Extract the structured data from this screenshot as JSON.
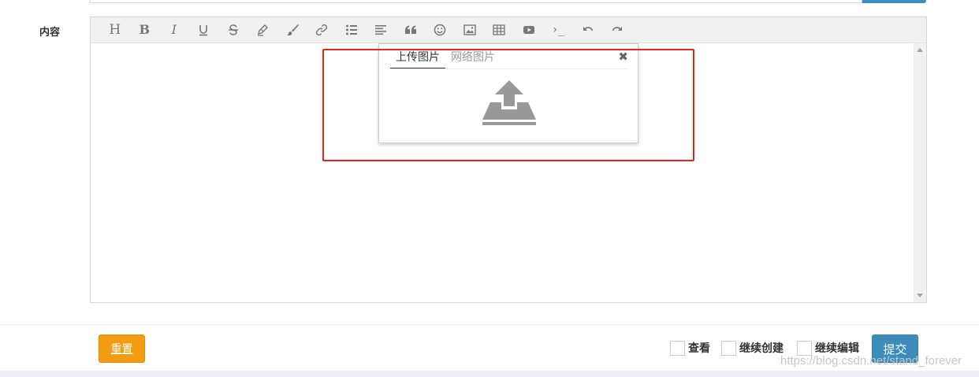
{
  "form": {
    "content_label": "内容"
  },
  "toolbar": {
    "heading_glyph": "H",
    "bold_glyph": "B",
    "italic_glyph": "I",
    "code_glyph": "›_",
    "items": [
      "heading-icon",
      "bold-icon",
      "italic-icon",
      "underline-icon",
      "strikethrough-icon",
      "highlighter-icon",
      "brush-icon",
      "link-icon",
      "bullet-list-icon",
      "align-left-icon",
      "quote-icon",
      "emoji-icon",
      "image-icon",
      "table-icon",
      "video-icon",
      "code-icon",
      "undo-icon",
      "redo-icon"
    ]
  },
  "image_popup": {
    "tabs": [
      "上传图片",
      "网络图片"
    ],
    "active_tab": 0,
    "close_glyph": "✖",
    "upload_icon": "upload-tray-icon"
  },
  "footer": {
    "reset_label": "重置",
    "view_label": "查看",
    "continue_create_label": "继续创建",
    "continue_edit_label": "继续编辑",
    "submit_label": "提交"
  },
  "watermark": "https://blog.csdn.net/stand_forever",
  "colors": {
    "primary": "#3c8dbc",
    "warning": "#f39c12",
    "highlight": "#e8261e"
  }
}
